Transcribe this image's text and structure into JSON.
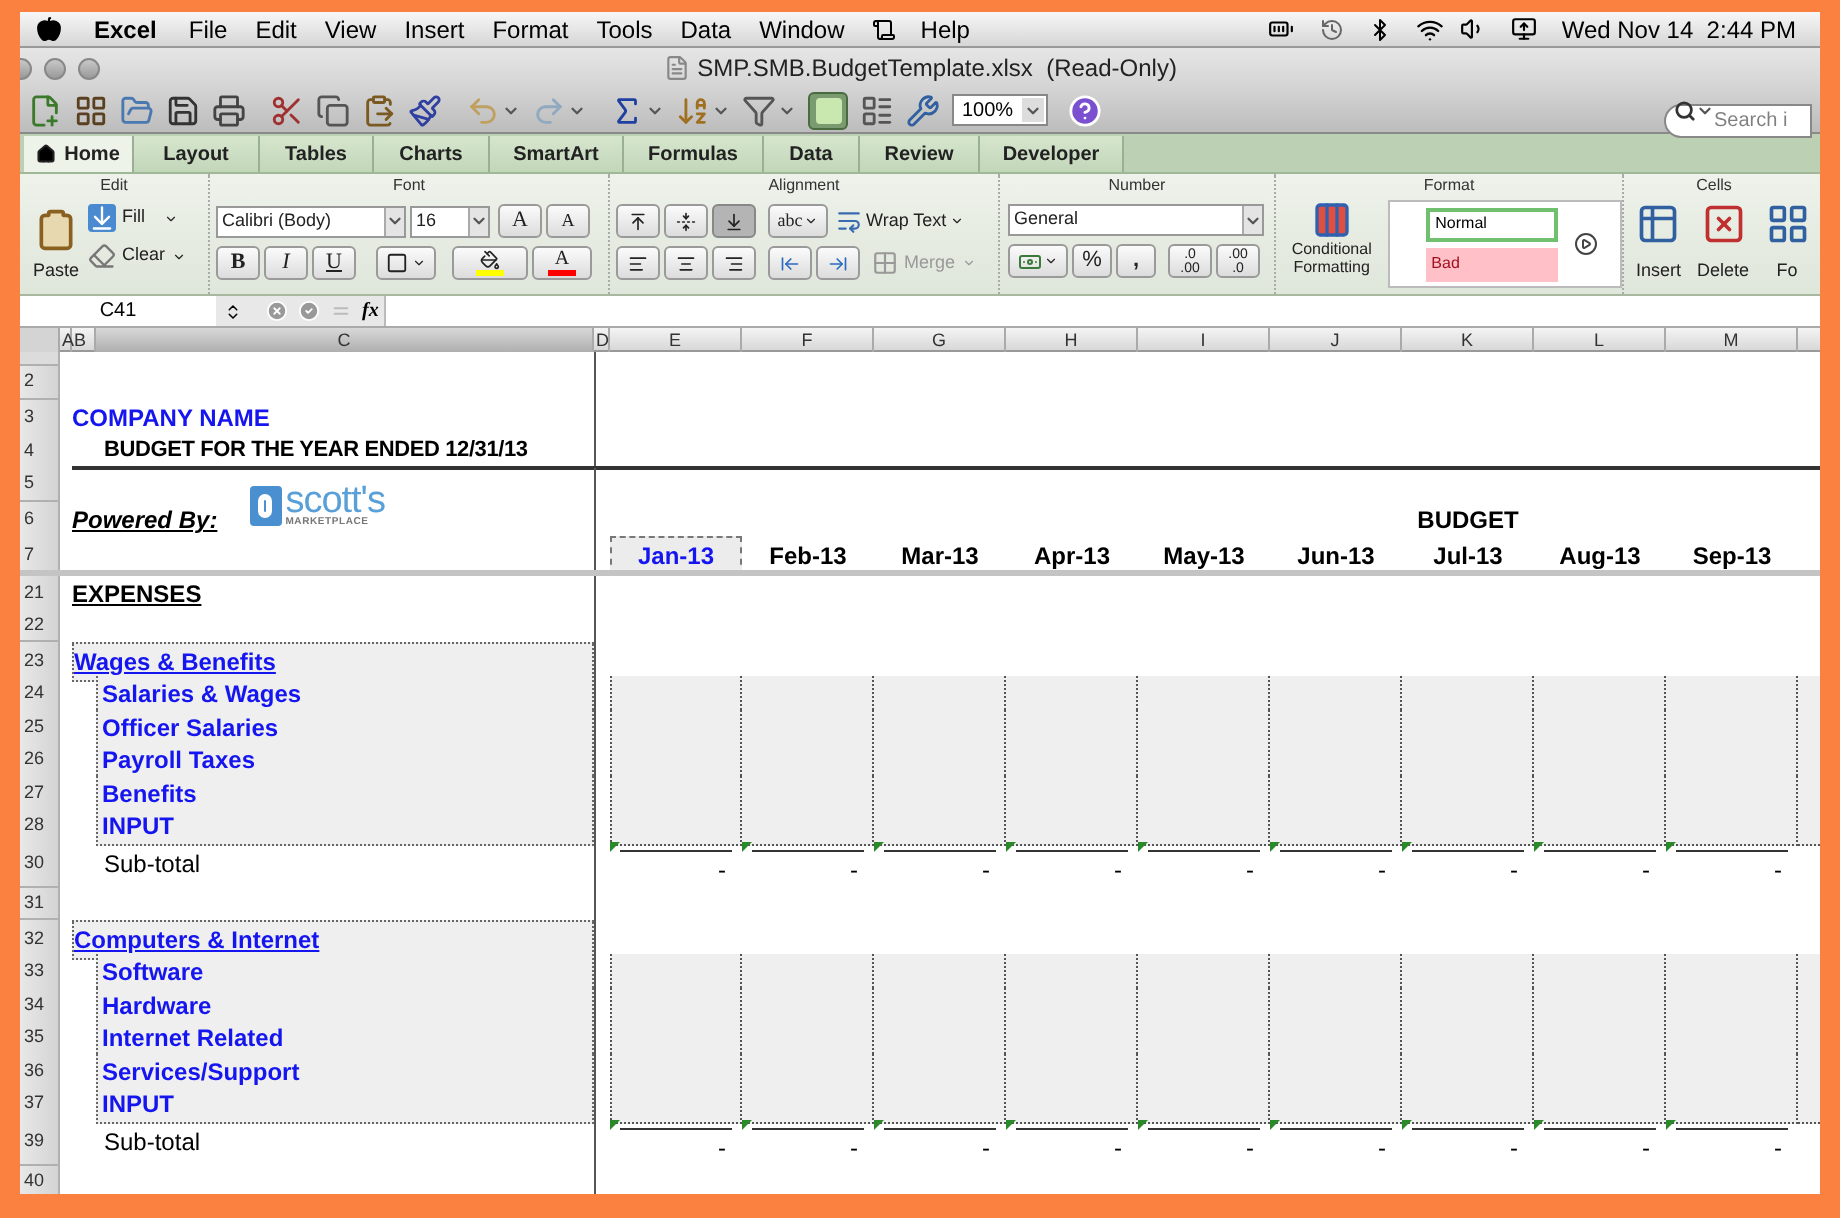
{
  "menu_bar": {
    "app": "Excel",
    "items": [
      "File",
      "Edit",
      "View",
      "Insert",
      "Format",
      "Tools",
      "Data",
      "Window",
      "Help"
    ],
    "clock": "Wed Nov 14  2:44 PM"
  },
  "window": {
    "title": "SMP.SMB.BudgetTemplate.xlsx  (Read-Only)"
  },
  "toolbar": {
    "zoom": "100%",
    "search": {
      "placeholder": "Search i"
    }
  },
  "ribbon_tabs": [
    {
      "label": "Home",
      "selected": true
    },
    {
      "label": "Layout",
      "selected": false
    },
    {
      "label": "Tables",
      "selected": false
    },
    {
      "label": "Charts",
      "selected": false
    },
    {
      "label": "SmartArt",
      "selected": false
    },
    {
      "label": "Formulas",
      "selected": false
    },
    {
      "label": "Data",
      "selected": false
    },
    {
      "label": "Review",
      "selected": false
    },
    {
      "label": "Developer",
      "selected": false
    }
  ],
  "ribbon": {
    "edit": {
      "title": "Edit",
      "paste": "Paste",
      "fill": "Fill",
      "clear": "Clear"
    },
    "font": {
      "title": "Font",
      "name": "Calibri (Body)",
      "size": "16",
      "grow": "A",
      "shrink": "A",
      "bold": "B",
      "italic": "I",
      "underline": "U",
      "font_color": "A"
    },
    "alignment": {
      "title": "Alignment",
      "orientation": "abc",
      "wrap": "Wrap Text",
      "merge": {
        "label": "Merge",
        "disabled": true
      }
    },
    "number": {
      "title": "Number",
      "format": "General",
      "percent": "%",
      "comma": ",",
      "increase_decimal": [
        ".0",
        ".00"
      ],
      "decrease_decimal": [
        ".00",
        ".0"
      ]
    },
    "format": {
      "title": "Format",
      "conditional": [
        "Conditional",
        "Formatting"
      ],
      "styles": [
        {
          "label": "Normal",
          "kind": "normal"
        },
        {
          "label": "Bad",
          "kind": "bad"
        }
      ]
    },
    "cells": {
      "title": "Cells",
      "buttons": [
        "Insert",
        "Delete",
        "Fo"
      ]
    }
  },
  "formula_bar": {
    "cell": "C41",
    "fx": "fx"
  },
  "columns": [
    "A",
    "B",
    "C",
    "D",
    "E",
    "F",
    "G",
    "H",
    "I",
    "J",
    "K",
    "L",
    "M"
  ],
  "sheet": {
    "header_rows": [
      "2",
      "3",
      "4",
      "5",
      "6",
      "7"
    ],
    "company": "COMPANY NAME",
    "title": "BUDGET FOR THE YEAR ENDED 12/31/13",
    "powered_by": "Powered By:",
    "logo": {
      "name": "scott's",
      "tagline": "MARKETPLACE"
    },
    "budget_heading": "BUDGET",
    "months": [
      {
        "label": "Jan-13",
        "selected": true
      },
      {
        "label": "Feb-13",
        "selected": false
      },
      {
        "label": "Mar-13",
        "selected": false
      },
      {
        "label": "Apr-13",
        "selected": false
      },
      {
        "label": "May-13",
        "selected": false
      },
      {
        "label": "Jun-13",
        "selected": false
      },
      {
        "label": "Jul-13",
        "selected": false
      },
      {
        "label": "Aug-13",
        "selected": false
      },
      {
        "label": "Sep-13",
        "selected": false
      }
    ],
    "section": {
      "row": "21",
      "title": "EXPENSES",
      "blank_row": "22"
    },
    "groups": [
      {
        "row": "23",
        "title": "Wages & Benefits",
        "items": [
          {
            "row": "24",
            "label": "Salaries & Wages"
          },
          {
            "row": "25",
            "label": "Officer Salaries"
          },
          {
            "row": "26",
            "label": "Payroll Taxes"
          },
          {
            "row": "27",
            "label": "Benefits"
          },
          {
            "row": "28",
            "label": "INPUT"
          }
        ],
        "subtotal": {
          "row": "30",
          "label": "Sub-total",
          "values": [
            "-",
            "-",
            "-",
            "-",
            "-",
            "-",
            "-",
            "-",
            "-"
          ]
        },
        "after": [
          "31"
        ]
      },
      {
        "row": "32",
        "title": "Computers & Internet",
        "items": [
          {
            "row": "33",
            "label": "Software"
          },
          {
            "row": "34",
            "label": "Hardware"
          },
          {
            "row": "35",
            "label": "Internet Related"
          },
          {
            "row": "36",
            "label": "Services/Support"
          },
          {
            "row": "37",
            "label": "INPUT"
          }
        ],
        "subtotal": {
          "row": "39",
          "label": "Sub-total",
          "values": [
            "-",
            "-",
            "-",
            "-",
            "-",
            "-",
            "-",
            "-",
            "-"
          ]
        },
        "after": [
          "40"
        ]
      }
    ]
  }
}
